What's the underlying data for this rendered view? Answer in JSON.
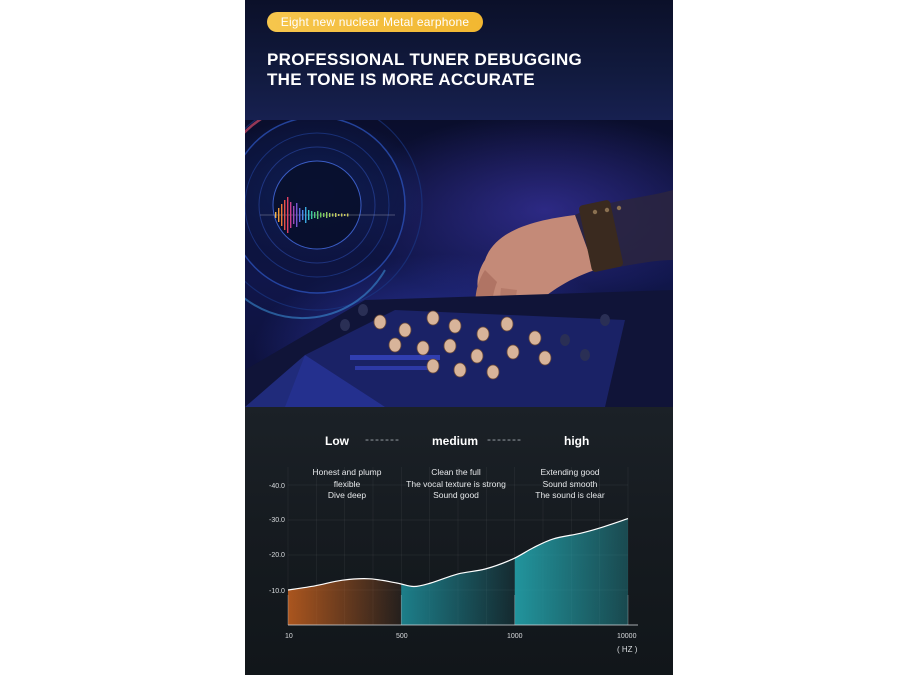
{
  "badge": "Eight new nuclear Metal earphone",
  "headline": [
    "PROFESSIONAL TUNER DEBUGGING",
    "THE TONE IS MORE ACCURATE"
  ],
  "icons": [
    "sound-wave-icon",
    "vinyl-record-icon"
  ],
  "colors": {
    "accent": "#f4c041",
    "background": "#0f1530",
    "low_fill": "#c5601f",
    "mid_fill": "#1e8a96",
    "high_fill": "#23a2ab"
  },
  "chart_data": {
    "type": "area",
    "bands": [
      {
        "label": "Low",
        "lines": [
          "Honest and plump",
          "flexible",
          "Dive deep"
        ]
      },
      {
        "label": "medium",
        "lines": [
          "Clean the full",
          "The vocal texture is strong",
          "Sound good"
        ]
      },
      {
        "label": "high",
        "lines": [
          "Extending good",
          "Sound smooth",
          "The sound is clear"
        ]
      }
    ],
    "band_separator": "-------",
    "y_ticks": [
      "-10.0",
      "-20.0",
      "-30.0",
      "-40.0"
    ],
    "x_ticks": [
      "10",
      "500",
      "1000",
      "10000"
    ],
    "x_unit": "( HZ )",
    "curve": [
      {
        "p": 0.0,
        "y": -10.0
      },
      {
        "p": 0.08,
        "y": -11.2
      },
      {
        "p": 0.16,
        "y": -12.8
      },
      {
        "p": 0.24,
        "y": -13.2
      },
      {
        "p": 0.32,
        "y": -12.0
      },
      {
        "p": 0.37,
        "y": -11.0
      },
      {
        "p": 0.42,
        "y": -12.0
      },
      {
        "p": 0.5,
        "y": -14.6
      },
      {
        "p": 0.58,
        "y": -16.0
      },
      {
        "p": 0.66,
        "y": -18.8
      },
      {
        "p": 0.72,
        "y": -22.0
      },
      {
        "p": 0.78,
        "y": -24.6
      },
      {
        "p": 0.86,
        "y": -26.2
      },
      {
        "p": 0.92,
        "y": -27.8
      },
      {
        "p": 1.0,
        "y": -30.4
      }
    ],
    "ylim": [
      0,
      -40
    ]
  }
}
